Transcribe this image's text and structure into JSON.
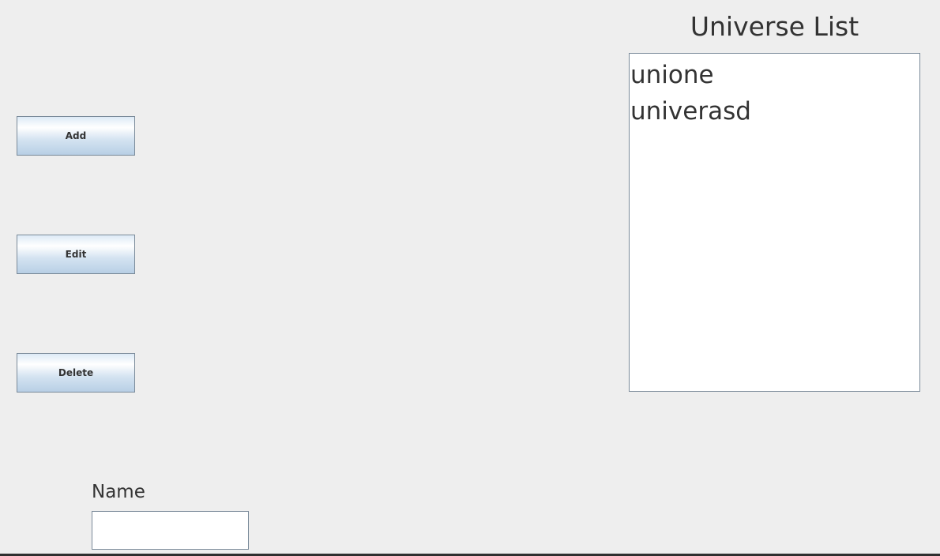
{
  "buttons": {
    "add_label": "Add",
    "edit_label": "Edit",
    "delete_label": "Delete"
  },
  "universe_list": {
    "title": "Universe List",
    "items": [
      "unione",
      "univerasd"
    ]
  },
  "name_field": {
    "label": "Name",
    "value": ""
  }
}
